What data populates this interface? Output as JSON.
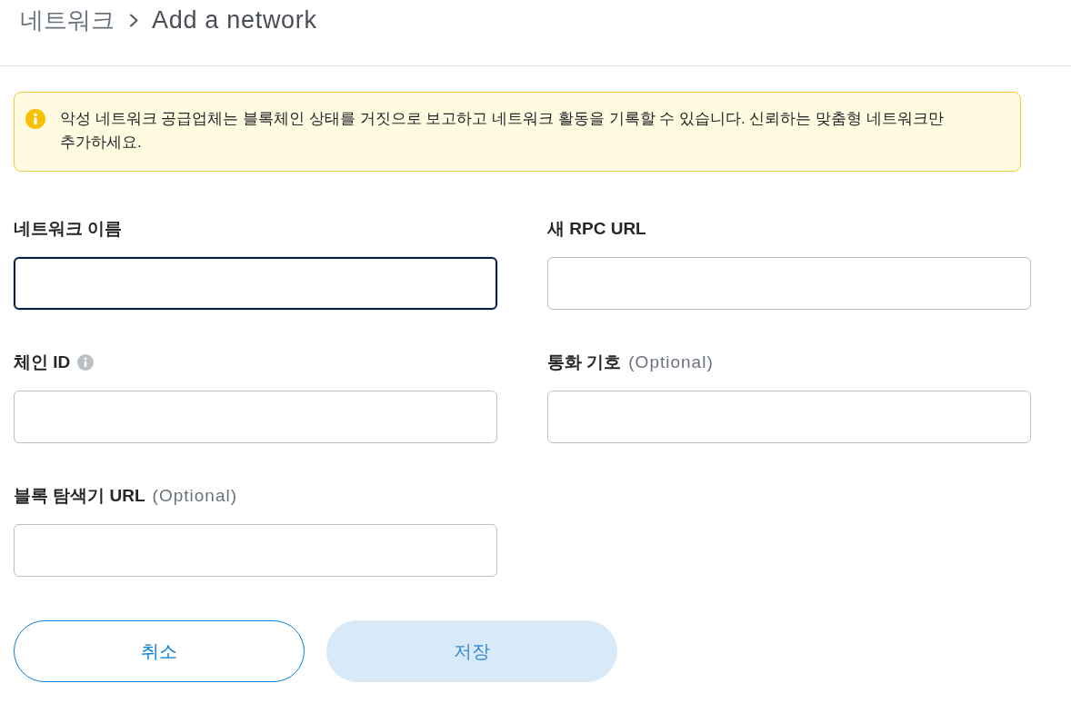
{
  "breadcrumb": {
    "parent": "네트워크",
    "current": "Add a network"
  },
  "alert": {
    "kind": "warning",
    "text": "악성 네트워크 공급업체는 블록체인 상태를 거짓으로 보고하고 네트워크 활동을 기록할 수 있습니다. 신뢰하는 맞춤형 네트워크만 추가하세요."
  },
  "fields": [
    {
      "label": "네트워크 이름",
      "focused": true
    },
    {
      "label": "새 RPC URL",
      "focused": false
    },
    {
      "label": "체인 ID",
      "info": true,
      "focused": false
    },
    {
      "label": "통화 기호",
      "optional": "(Optional)",
      "focused": false
    },
    {
      "label": "블록 탐색기 URL",
      "optional": "(Optional)",
      "focused": false
    }
  ],
  "buttons": [
    {
      "label": "취소",
      "kind": "secondary",
      "disabled": false
    },
    {
      "label": "저장",
      "kind": "primary",
      "disabled": true
    }
  ]
}
